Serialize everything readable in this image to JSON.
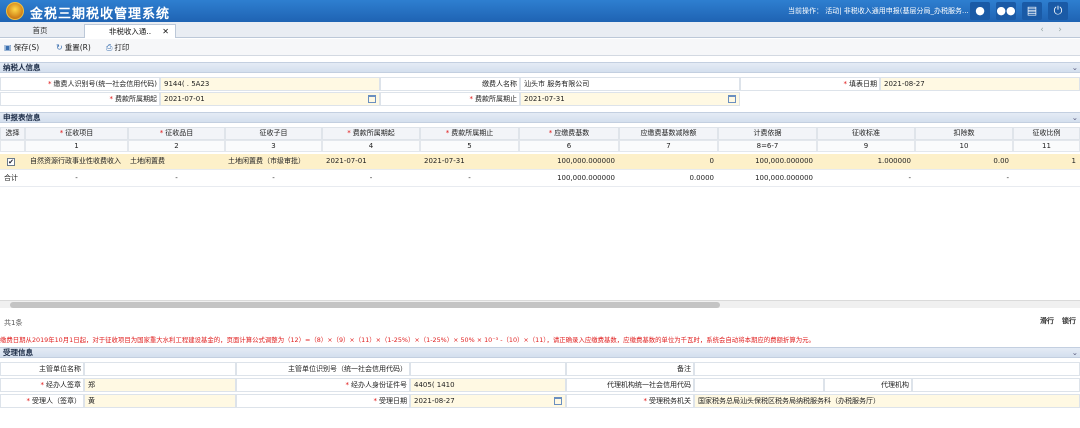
{
  "app": {
    "title": "金税三期税收管理系统",
    "current_operation": "当前操作： 活动| 非税收入通用申报(基层分局_办税服务..."
  },
  "tabs": [
    {
      "label": "首页"
    },
    {
      "label": "非税收入通..",
      "close": "✕"
    }
  ],
  "header_icons": [
    "user-icon",
    "group-icon",
    "chat-icon",
    "power-icon"
  ],
  "toolbar": {
    "save_label": "保存(S)",
    "reset_label": "重置(R)",
    "print_label": "打印"
  },
  "taxpayer_section": {
    "title": "纳税人信息",
    "taxpayer_id_label": "缴费人识别号(统一社会信用代码)",
    "taxpayer_id_value": "9144(          .      5A23",
    "taxpayer_name_label": "缴费人名称",
    "taxpayer_name_value": "汕头市                          服务有限公司",
    "fill_date_label": "填表日期",
    "fill_date_value": "2021-08-27",
    "period_start_label": "费款所属期起",
    "period_start_value": "2021-07-01",
    "period_end_label": "费款所属期止",
    "period_end_value": "2021-07-31"
  },
  "declaration_section": {
    "title": "申报表信息",
    "columns": [
      {
        "label": "选择",
        "required": false,
        "num": ""
      },
      {
        "label": "征收项目",
        "required": true,
        "num": "1"
      },
      {
        "label": "征收品目",
        "required": true,
        "num": "2"
      },
      {
        "label": "征收子目",
        "required": false,
        "num": "3"
      },
      {
        "label": "费款所属期起",
        "required": true,
        "num": "4"
      },
      {
        "label": "费款所属期止",
        "required": true,
        "num": "5"
      },
      {
        "label": "应缴费基数",
        "required": true,
        "num": "6"
      },
      {
        "label": "应缴费基数减除额",
        "required": false,
        "num": "7"
      },
      {
        "label": "计费依据",
        "required": false,
        "num": "8=6-7"
      },
      {
        "label": "征收标准",
        "required": false,
        "num": "9"
      },
      {
        "label": "扣除数",
        "required": false,
        "num": "10"
      },
      {
        "label": "征收比例",
        "required": false,
        "num": "11"
      }
    ],
    "rows": [
      {
        "checked": "✔",
        "item": "自然资源行政事业性收费收入",
        "category": "土地闲置费",
        "subcategory": "土地闲置费（市级审批）",
        "start": "2021-07-01",
        "end": "2021-07-31",
        "base": "100,000.000000",
        "deduct_base": "0",
        "basis": "100,000.000000",
        "standard": "1.000000",
        "deduction": "0.00",
        "ratio": "1"
      }
    ],
    "total": {
      "label": "合计",
      "item": "-",
      "category": "-",
      "subcategory": "-",
      "start": "-",
      "end": "-",
      "base": "100,000.000000",
      "deduct_base": "0.0000",
      "basis": "100,000.000000",
      "standard": "-",
      "deduction": "-"
    }
  },
  "footer": {
    "count": "共1条",
    "slide": "滑行",
    "lock": "锁行"
  },
  "notice": "缴费日期从2019年10月1日起，对于征收项目为国家重大水利工程建设基金的，页面计算公式调整为（12）=（8）×（9）×（11）×（1-25%）×（1-25%）× 50% × 10⁻³ -（10）×（11），请正确录入应缴费基数，应缴费基数的单位为千瓦时，系统会自动将本期应的费额折算为元。",
  "acceptance_section": {
    "title": "受理信息",
    "competent_unit_name_label": "主管单位名称",
    "competent_unit_id_label": "主管单位识别号（统一社会信用代码）",
    "remark_label": "备注",
    "agent_sign_label": "经办人签章",
    "agent_sign_value": "郑",
    "agent_id_label": "经办人身份证件号",
    "agent_id_value": "4405(                1410",
    "agency_code_label": "代理机构统一社会信用代码",
    "agency_label": "代理机构",
    "receiver_label": "受理人（签章）",
    "receiver_value": "黄",
    "accept_date_label": "受理日期",
    "accept_date_value": "2021-08-27",
    "tax_office_label": "受理税务机关",
    "tax_office_value": "国家税务总局汕头保税区税务局纳税服务科（办税服务厅）"
  }
}
